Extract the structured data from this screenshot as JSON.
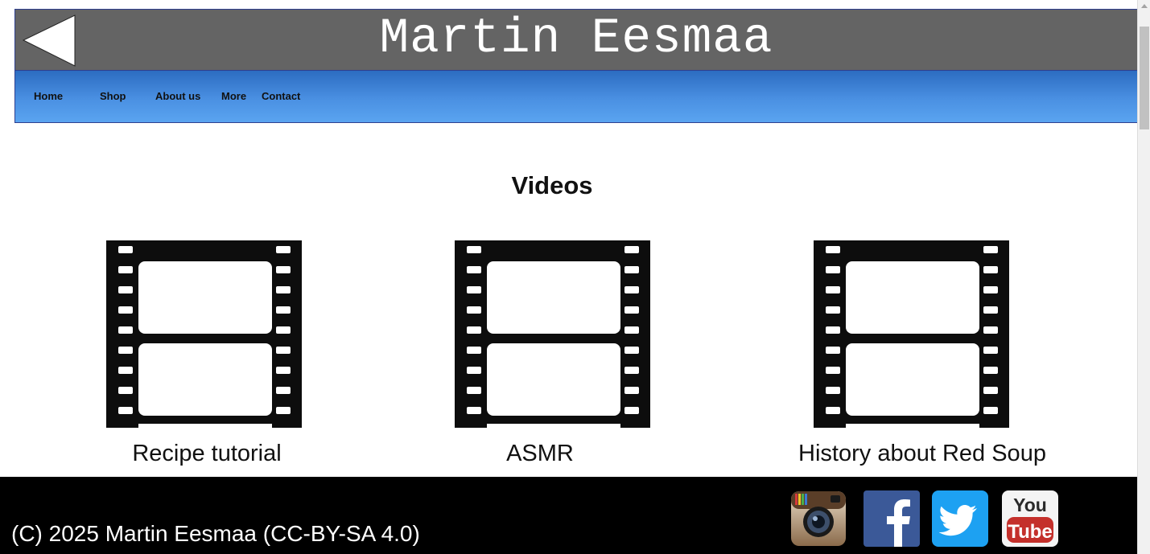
{
  "header": {
    "title": "Martin Eesmaa",
    "back_icon": "back-arrow-icon"
  },
  "nav": {
    "items": [
      {
        "label": "Home"
      },
      {
        "label": "Shop"
      },
      {
        "label": "About us"
      },
      {
        "label": "More"
      },
      {
        "label": "Contact"
      }
    ]
  },
  "main": {
    "heading": "Videos",
    "videos": [
      {
        "caption": "Recipe tutorial",
        "icon": "film-strip-icon"
      },
      {
        "caption": "ASMR",
        "icon": "film-strip-icon"
      },
      {
        "caption": "History about Red Soup",
        "icon": "film-strip-icon"
      }
    ]
  },
  "footer": {
    "copyright": "(C) 2025 Martin Eesmaa (CC-BY-SA 4.0)",
    "social": [
      {
        "icon": "instagram-icon"
      },
      {
        "icon": "facebook-icon",
        "text": "f"
      },
      {
        "icon": "twitter-icon"
      },
      {
        "icon": "youtube-icon",
        "text_top": "You",
        "text_bottom": "Tube"
      }
    ]
  },
  "colors": {
    "header_bg": "#646464",
    "nav_gradient_top": "#2c6cc1",
    "nav_gradient_bottom": "#5aa4f0",
    "footer_bg": "#000000",
    "facebook": "#3b5998",
    "twitter": "#1da1f2",
    "youtube": "#c4302b"
  }
}
